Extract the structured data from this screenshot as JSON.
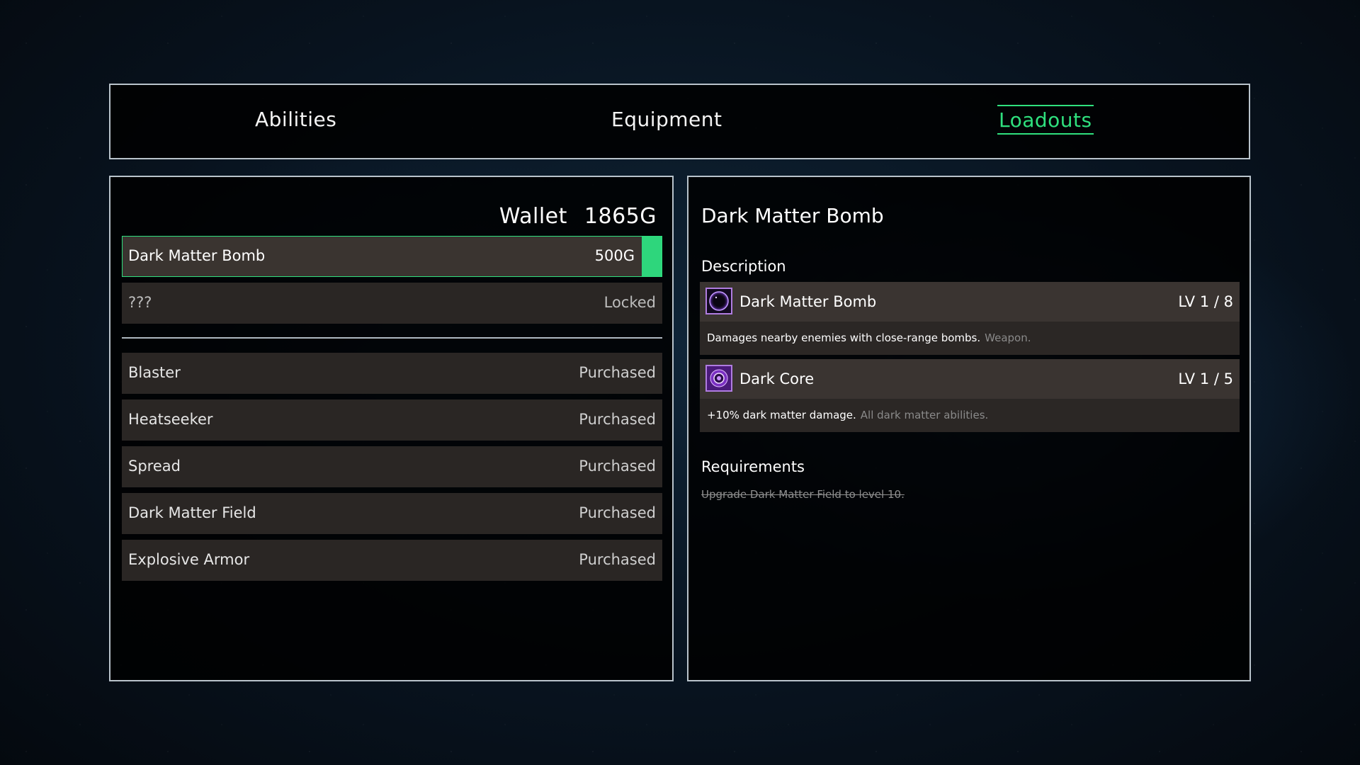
{
  "tabs": [
    {
      "label": "Abilities",
      "active": false
    },
    {
      "label": "Equipment",
      "active": false
    },
    {
      "label": "Loadouts",
      "active": true
    }
  ],
  "colors": {
    "accent": "#2fe07e",
    "panel_border": "#b9c3cb",
    "row_bg": "#2a2624",
    "row_selected_bg": "#3a3430",
    "icon_border": "#b07ce0"
  },
  "wallet": {
    "label": "Wallet",
    "amount": "1865G"
  },
  "shop": {
    "available": [
      {
        "name": "Dark Matter Bomb",
        "status": "500G",
        "selected": true
      },
      {
        "name": "???",
        "status": "Locked",
        "selected": false
      }
    ],
    "purchased": [
      {
        "name": "Blaster",
        "status": "Purchased"
      },
      {
        "name": "Heatseeker",
        "status": "Purchased"
      },
      {
        "name": "Spread",
        "status": "Purchased"
      },
      {
        "name": "Dark Matter Field",
        "status": "Purchased"
      },
      {
        "name": "Explosive Armor",
        "status": "Purchased"
      }
    ]
  },
  "detail": {
    "title": "Dark Matter Bomb",
    "description_label": "Description",
    "abilities": [
      {
        "icon": "dark-matter-bomb-icon",
        "name": "Dark Matter Bomb",
        "level": "LV 1 / 8",
        "description": "Damages nearby enemies with close-range bombs.",
        "tag": "Weapon."
      },
      {
        "icon": "dark-core-icon",
        "name": "Dark Core",
        "level": "LV 1 / 5",
        "description": "+10% dark matter damage.",
        "tag": "All dark matter abilities."
      }
    ],
    "requirements_label": "Requirements",
    "requirement": "Upgrade Dark Matter Field to level 10."
  }
}
